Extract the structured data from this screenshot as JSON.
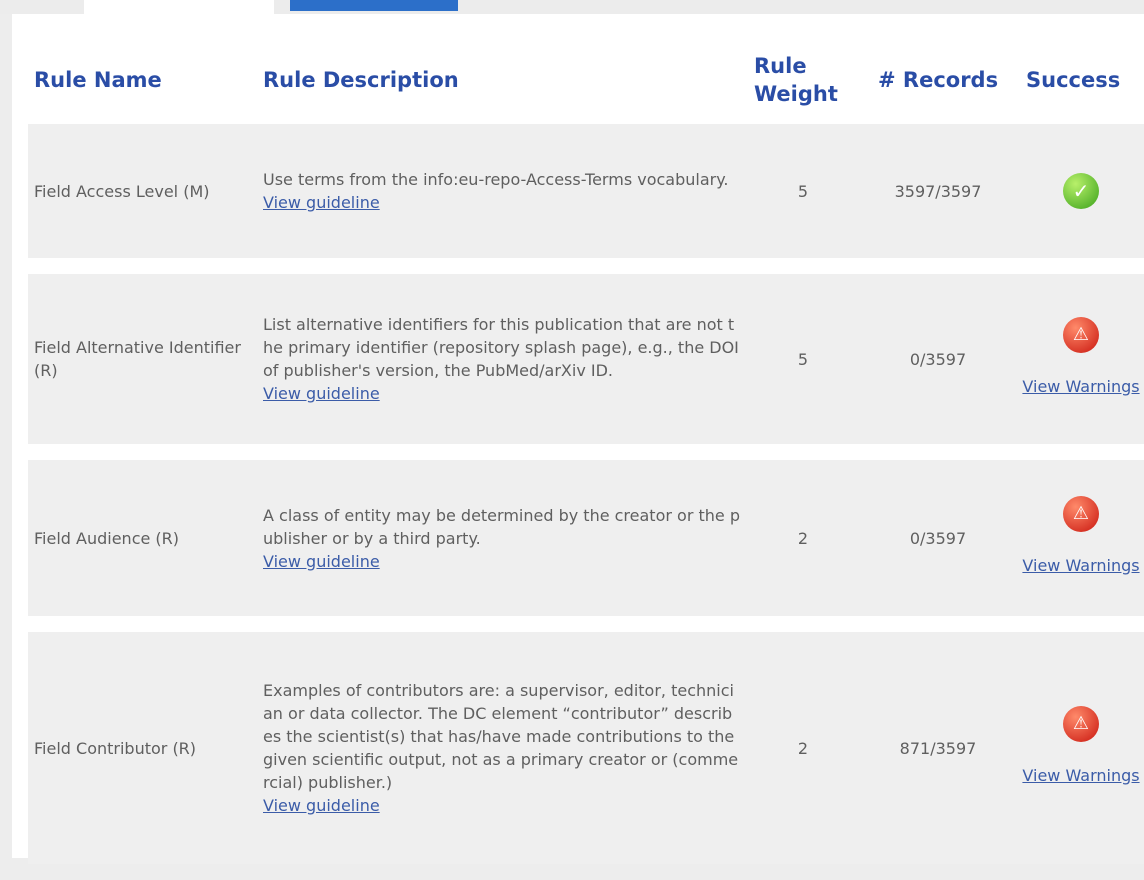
{
  "headers": {
    "rule_name": "Rule Name",
    "rule_description": "Rule Description",
    "rule_weight": "Rule Weight",
    "records": "# Records",
    "success": "Success"
  },
  "rows": [
    {
      "name": "Field Access Level (M)",
      "description": "Use terms from the info:eu-repo-Access-Terms vocabulary.",
      "guideline": "View guideline",
      "weight": "5",
      "records": "3597/3597",
      "status": "success",
      "status_icon": "check-icon",
      "warnings_link": ""
    },
    {
      "name": "Field Alternative Identifier (R)",
      "description": "List alternative identifiers for this publication that are not the primary identifier (repository splash page), e.g., the DOI of publisher's version, the PubMed/arXiv ID.",
      "guideline": "View guideline",
      "weight": "5",
      "records": "0/3597",
      "status": "warning",
      "status_icon": "warning-icon",
      "warnings_link": "View Warnings"
    },
    {
      "name": "Field Audience (R)",
      "description": "A class of entity may be determined by the creator or the publisher or by a third party.",
      "guideline": "View guideline",
      "weight": "2",
      "records": "0/3597",
      "status": "warning",
      "status_icon": "warning-icon",
      "warnings_link": "View Warnings"
    },
    {
      "name": "Field Contributor (R)",
      "description": "Examples of contributors are: a supervisor, editor, technician or data collector. The DC element “contributor” describes the scientist(s) that has/have made contributions to the given scientific output, not as a primary creator or (commercial) publisher.)",
      "guideline": "View guideline",
      "weight": "2",
      "records": "871/3597",
      "status": "warning",
      "status_icon": "warning-icon",
      "warnings_link": "View Warnings"
    }
  ],
  "colors": {
    "header_text": "#2a4da6",
    "link": "#3b5ca8",
    "tab_active": "#2c6fc9",
    "success": "#3aa11a",
    "warning": "#c9160e"
  }
}
